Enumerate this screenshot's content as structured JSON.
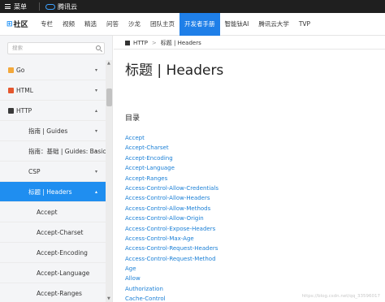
{
  "topbar": {
    "menu_label": "菜单",
    "brand": "腾讯云"
  },
  "navbar": {
    "logo": "社区",
    "items": [
      {
        "label": "专栏"
      },
      {
        "label": "视频"
      },
      {
        "label": "精选"
      },
      {
        "label": "问答"
      },
      {
        "label": "沙龙"
      },
      {
        "label": "团队主页"
      },
      {
        "label": "开发者手册",
        "active": true
      },
      {
        "label": "智能钛AI"
      },
      {
        "label": "腾讯云大学"
      },
      {
        "label": "TVP"
      }
    ]
  },
  "sidebar": {
    "search_placeholder": "搜索",
    "items": [
      {
        "label": "Go",
        "level": 0,
        "badge_color": "#f3a83b",
        "chevron": "▾"
      },
      {
        "label": "HTML",
        "level": 0,
        "badge_color": "#e4572e",
        "chevron": "▾"
      },
      {
        "label": "HTTP",
        "level": 0,
        "badge_color": "#3a3a3a",
        "chevron": "▴"
      },
      {
        "label": "指南 | Guides",
        "level": 1,
        "chevron": "▾"
      },
      {
        "label": "指南：基础 | Guides: Basics",
        "level": 1,
        "chevron": "▾"
      },
      {
        "label": "CSP",
        "level": 1,
        "chevron": "▾"
      },
      {
        "label": "标题 | Headers",
        "level": 1,
        "chevron": "▴",
        "active": true
      },
      {
        "label": "Accept",
        "level": 2
      },
      {
        "label": "Accept-Charset",
        "level": 2
      },
      {
        "label": "Accept-Encoding",
        "level": 2
      },
      {
        "label": "Accept-Language",
        "level": 2
      },
      {
        "label": "Accept-Ranges",
        "level": 2
      }
    ]
  },
  "main": {
    "breadcrumb": {
      "section": "HTTP",
      "page": "标题 | Headers"
    },
    "title": "标题 | Headers",
    "toc_heading": "目录",
    "toc": [
      "Accept",
      "Accept-Charset",
      "Accept-Encoding",
      "Accept-Language",
      "Accept-Ranges",
      "Access-Control-Allow-Credentials",
      "Access-Control-Allow-Headers",
      "Access-Control-Allow-Methods",
      "Access-Control-Allow-Origin",
      "Access-Control-Expose-Headers",
      "Access-Control-Max-Age",
      "Access-Control-Request-Headers",
      "Access-Control-Request-Method",
      "Age",
      "Allow",
      "Authorization",
      "Cache-Control"
    ],
    "watermark": "https://blog.csdn.net/qq_33596017"
  },
  "colors": {
    "accent": "#1f8ef0",
    "link": "#1a7fd6",
    "topbar": "#1f1f1f"
  }
}
